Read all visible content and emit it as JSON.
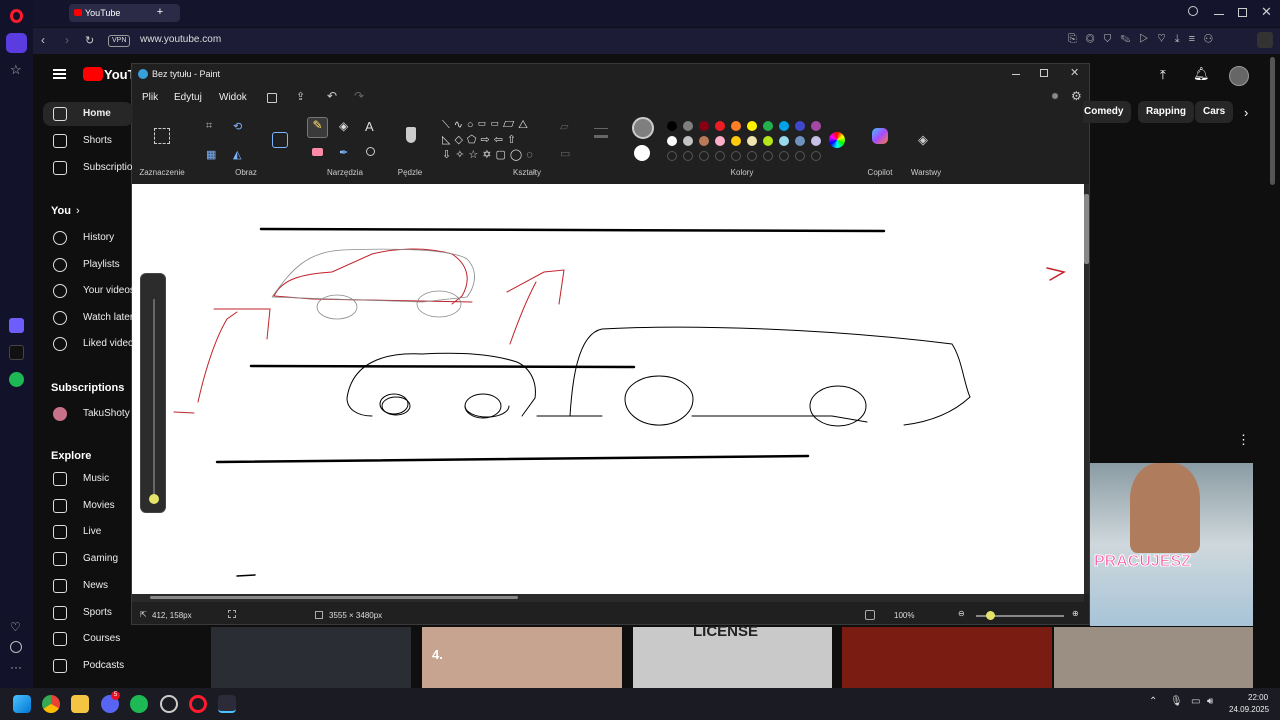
{
  "browser": {
    "tab_title": "YouTube",
    "url": "www.youtube.com",
    "vpn_badge": "VPN"
  },
  "youtube": {
    "logo_text": "YouTube",
    "nav": [
      {
        "label": "Home",
        "icon": "home-icon"
      },
      {
        "label": "Shorts",
        "icon": "shorts-icon"
      },
      {
        "label": "Subscriptions",
        "icon": "subscriptions-icon"
      }
    ],
    "you_header": "You",
    "you_items": [
      {
        "label": "History",
        "icon": "history-icon"
      },
      {
        "label": "Playlists",
        "icon": "playlists-icon"
      },
      {
        "label": "Your videos",
        "icon": "your-videos-icon"
      },
      {
        "label": "Watch later",
        "icon": "watch-later-icon"
      },
      {
        "label": "Liked videos",
        "icon": "liked-icon"
      }
    ],
    "subs_header": "Subscriptions",
    "subs_items": [
      {
        "label": "TakuShoty"
      }
    ],
    "explore_header": "Explore",
    "explore_items": [
      {
        "label": "Music",
        "icon": "music-icon"
      },
      {
        "label": "Movies",
        "icon": "movies-icon"
      },
      {
        "label": "Live",
        "icon": "live-icon"
      },
      {
        "label": "Gaming",
        "icon": "gaming-icon"
      },
      {
        "label": "News",
        "icon": "news-icon"
      },
      {
        "label": "Sports",
        "icon": "sports-icon"
      },
      {
        "label": "Courses",
        "icon": "courses-icon"
      },
      {
        "label": "Podcasts",
        "icon": "podcasts-icon"
      }
    ],
    "chips": [
      "Comedy",
      "Rapping",
      "Cars"
    ],
    "video_overlay_text": "PRACUJESZ",
    "thumb_texts": [
      "4.",
      "LICENSE"
    ]
  },
  "paint": {
    "title": "Bez tytułu - Paint",
    "menus": [
      "Plik",
      "Edytuj",
      "Widok"
    ],
    "groups": {
      "selection": "Zaznaczenie",
      "image": "Obraz",
      "tools": "Narzędzia",
      "brushes": "Pędzle",
      "shapes": "Kształty",
      "colors": "Kolory",
      "copilot": "Copilot",
      "layers": "Warstwy"
    },
    "colors_row1": [
      "#000000",
      "#7f7f7f",
      "#880015",
      "#ed1c24",
      "#ff7f27",
      "#fff200",
      "#22b14c",
      "#00a2e8",
      "#3f48cc",
      "#a349a4"
    ],
    "colors_row2": [
      "#ffffff",
      "#c3c3c3",
      "#b97a57",
      "#ffaec9",
      "#ffc90e",
      "#efe4b0",
      "#b5e61d",
      "#99d9ea",
      "#7092be",
      "#c8bfe7"
    ],
    "primary_color": "#7f7f7f",
    "secondary_color": "#ffffff",
    "status": {
      "cursor": "412, 158px",
      "size": "3555 × 3480px",
      "zoom": "100%"
    }
  },
  "taskbar": {
    "time": "22:00",
    "date": "24.09.2025",
    "discord_badge": "5"
  }
}
